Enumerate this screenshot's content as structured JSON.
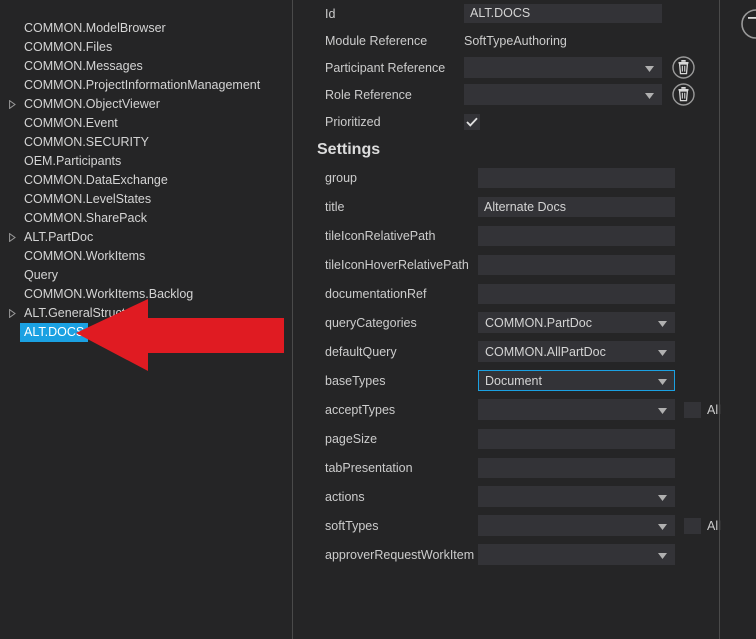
{
  "tree": {
    "items": [
      {
        "label": "COMMON.ModelBrowser",
        "expandable": false,
        "selected": false
      },
      {
        "label": "COMMON.Files",
        "expandable": false,
        "selected": false
      },
      {
        "label": "COMMON.Messages",
        "expandable": false,
        "selected": false
      },
      {
        "label": "COMMON.ProjectInformationManagement",
        "expandable": false,
        "selected": false
      },
      {
        "label": "COMMON.ObjectViewer",
        "expandable": true,
        "selected": false
      },
      {
        "label": "COMMON.Event",
        "expandable": false,
        "selected": false
      },
      {
        "label": "COMMON.SECURITY",
        "expandable": false,
        "selected": false
      },
      {
        "label": "OEM.Participants",
        "expandable": false,
        "selected": false
      },
      {
        "label": "COMMON.DataExchange",
        "expandable": false,
        "selected": false
      },
      {
        "label": "COMMON.LevelStates",
        "expandable": false,
        "selected": false
      },
      {
        "label": "COMMON.SharePack",
        "expandable": false,
        "selected": false
      },
      {
        "label": "ALT.PartDoc",
        "expandable": true,
        "selected": false
      },
      {
        "label": "COMMON.WorkItems",
        "expandable": false,
        "selected": false
      },
      {
        "label": "Query",
        "expandable": false,
        "selected": false
      },
      {
        "label": "COMMON.WorkItems.Backlog",
        "expandable": false,
        "selected": false
      },
      {
        "label": "ALT.GeneralStructure",
        "expandable": true,
        "selected": false
      },
      {
        "label": "ALT.DOCS",
        "expandable": false,
        "selected": true
      }
    ]
  },
  "detail": {
    "id": {
      "label": "Id",
      "value": "ALT.DOCS"
    },
    "module_reference": {
      "label": "Module Reference",
      "value": "SoftTypeAuthoring"
    },
    "participant_reference": {
      "label": "Participant Reference",
      "value": ""
    },
    "role_reference": {
      "label": "Role Reference",
      "value": ""
    },
    "prioritized": {
      "label": "Prioritized",
      "checked": true
    },
    "settings_title": "Settings",
    "settings": [
      {
        "label": "group",
        "type": "text",
        "value": "",
        "all": false
      },
      {
        "label": "title",
        "type": "text",
        "value": "Alternate Docs",
        "all": false
      },
      {
        "label": "tileIconRelativePath",
        "type": "text",
        "value": "",
        "all": false
      },
      {
        "label": "tileIconHoverRelativePath",
        "type": "text",
        "value": "",
        "all": false
      },
      {
        "label": "documentationRef",
        "type": "text",
        "value": "",
        "all": false
      },
      {
        "label": "queryCategories",
        "type": "combo",
        "value": "COMMON.PartDoc",
        "all": false,
        "focused": false
      },
      {
        "label": "defaultQuery",
        "type": "combo",
        "value": "COMMON.AllPartDoc",
        "all": false,
        "focused": false
      },
      {
        "label": "baseTypes",
        "type": "combo",
        "value": "Document",
        "all": false,
        "focused": true
      },
      {
        "label": "acceptTypes",
        "type": "combo",
        "value": "",
        "all": true,
        "focused": false
      },
      {
        "label": "pageSize",
        "type": "text",
        "value": "",
        "all": false
      },
      {
        "label": "tabPresentation",
        "type": "text",
        "value": "",
        "all": false
      },
      {
        "label": "actions",
        "type": "combo",
        "value": "",
        "all": false,
        "focused": false
      },
      {
        "label": "softTypes",
        "type": "combo",
        "value": "",
        "all": true,
        "focused": false
      },
      {
        "label": "approverRequestWorkItem",
        "type": "combo",
        "value": "",
        "all": false,
        "focused": false
      }
    ],
    "all_checkbox_label": "All"
  },
  "colors": {
    "background": "#252526",
    "field": "#333337",
    "selection": "#1ba1e2",
    "focus_border": "#1ba1e2",
    "text": "#cccccc",
    "annotation_arrow": "#e01b22"
  },
  "annotation": {
    "arrow": {
      "direction": "left",
      "points_at": "ALT.DOCS"
    }
  }
}
